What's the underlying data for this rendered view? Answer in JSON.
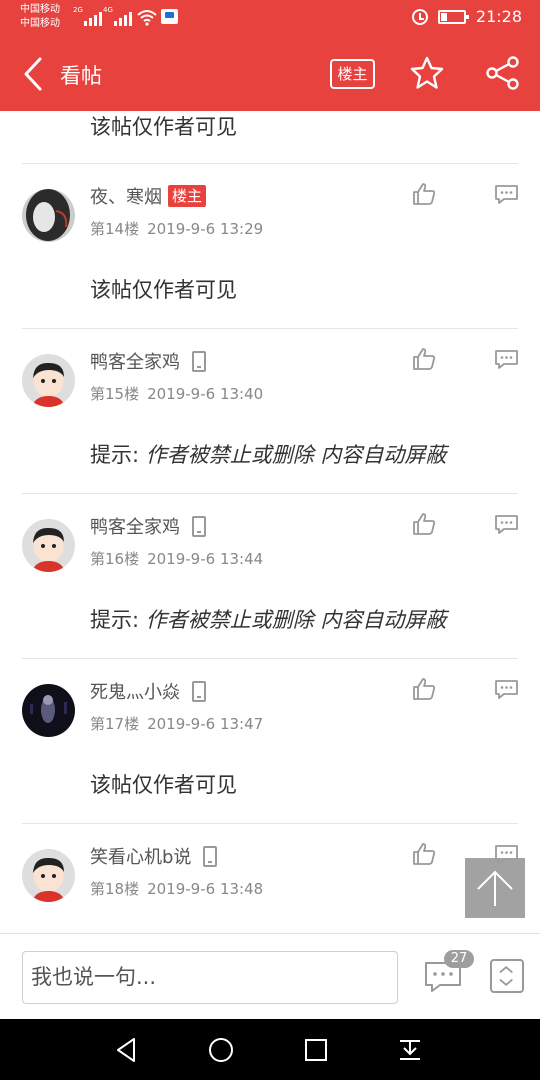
{
  "status_bar": {
    "carrier_1": "中国移动",
    "carrier_2": "中国移动",
    "net_1": "2G",
    "net_2": "4G",
    "time": "21:28"
  },
  "header": {
    "title": "看帖",
    "owner_filter": "楼主",
    "icons": [
      "back-icon",
      "star-icon",
      "share-icon"
    ]
  },
  "top_post": {
    "content": "该帖仅作者可见"
  },
  "posts": [
    {
      "username": "夜、寒烟",
      "tag": "楼主",
      "floor": "第14楼",
      "date": "2019-9-6 13:29",
      "content": "该帖仅作者可见"
    },
    {
      "username": "鸭客全家鸡",
      "floor": "第15楼",
      "date": "2019-9-6 13:40",
      "content_prefix": "提示:",
      "content_italic": " 作者被禁止或删除 内容自动屏蔽"
    },
    {
      "username": "鸭客全家鸡",
      "floor": "第16楼",
      "date": "2019-9-6 13:44",
      "content_prefix": "提示:",
      "content_italic": " 作者被禁止或删除 内容自动屏蔽"
    },
    {
      "username": "死鬼灬小焱",
      "floor": "第17楼",
      "date": "2019-9-6 13:47",
      "content": "该帖仅作者可见"
    },
    {
      "username": "笑看心机b说",
      "floor": "第18楼",
      "date": "2019-9-6 13:48"
    }
  ],
  "bottom_bar": {
    "input_placeholder": "我也说一句...",
    "comment_count": "27"
  },
  "colors": {
    "brand": "#e8423f",
    "muted": "#888888"
  }
}
